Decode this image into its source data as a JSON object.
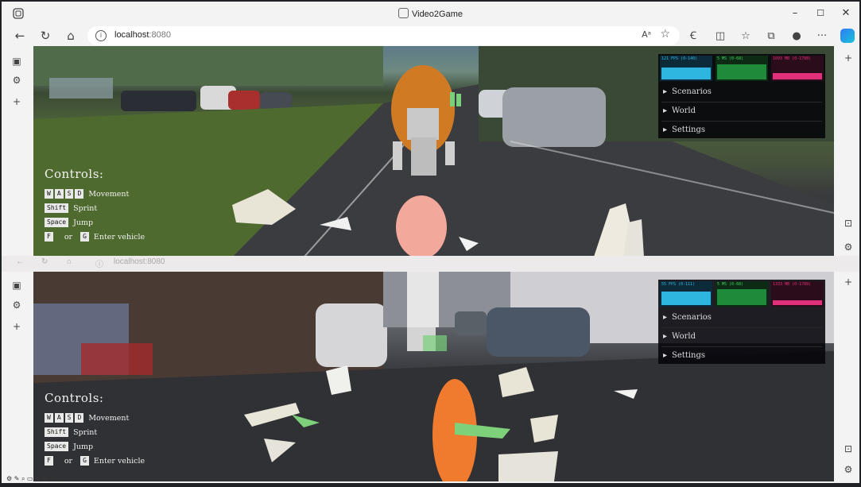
{
  "window": {
    "title": "Video2Game"
  },
  "toolbar": {
    "url_host": "localhost",
    "url_port": ":8080",
    "read_aloud": "Aᵃ"
  },
  "ghost_url": "localhost:8080",
  "controls": {
    "heading": "Controls:",
    "rows": [
      {
        "keys": [
          "W",
          "A",
          "S",
          "D"
        ],
        "label": "Movement"
      },
      {
        "keys": [
          "Shift"
        ],
        "label": "Sprint"
      },
      {
        "keys": [
          "Space"
        ],
        "label": "Jump"
      },
      {
        "keys": [
          "F",
          "G"
        ],
        "separator": "or",
        "label": "Enter vehicle"
      }
    ]
  },
  "panel": {
    "menu": [
      "Scenarios",
      "World",
      "Settings"
    ]
  },
  "viewports": [
    {
      "stats": [
        "121 FPS (0-140)",
        "5 MS (0-68)",
        "1093 MB (0-1788)"
      ],
      "stat_levels": [
        0.62,
        0.78,
        0.32
      ]
    },
    {
      "stats": [
        "55 FPS (0-111)",
        "5 MS (0-68)",
        "1333 MB (0-1788)"
      ],
      "stat_levels": [
        0.7,
        0.85,
        0.25
      ]
    }
  ],
  "colors": {
    "fps": "#2fb6e0",
    "ms": "#1f8a3a",
    "mb": "#e0307a"
  },
  "icons": [
    "app-icon",
    "back-icon",
    "refresh-icon",
    "home-icon",
    "info-icon",
    "star-icon",
    "extensions-icon",
    "split-screen-icon",
    "favorites-icon",
    "collections-icon",
    "profile-icon",
    "more-icon",
    "copilot-icon",
    "sidebar-toggle-icon",
    "gear-icon",
    "add-icon"
  ]
}
